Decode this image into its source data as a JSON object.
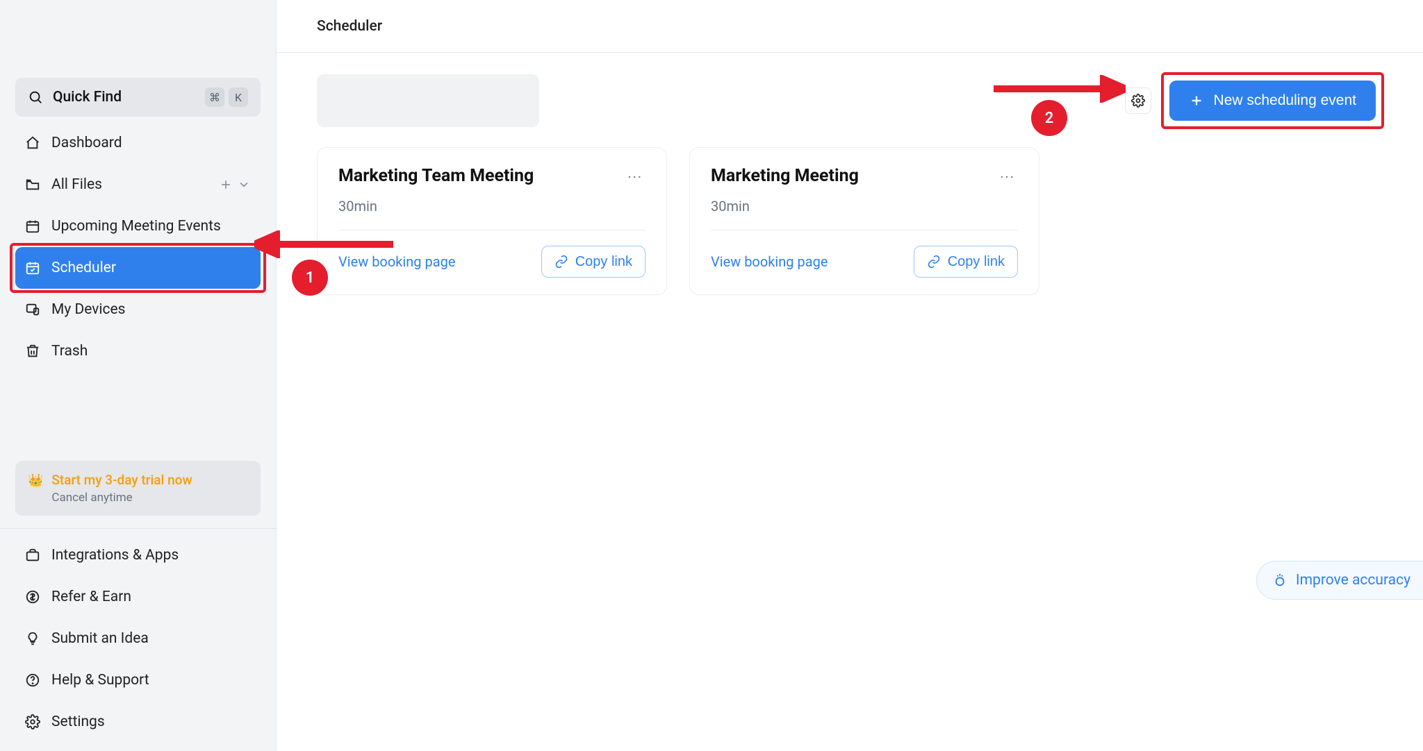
{
  "sidebar": {
    "quick_find": {
      "label": "Quick Find",
      "shortcut_mod": "⌘",
      "shortcut_key": "K"
    },
    "items": [
      {
        "label": "Dashboard"
      },
      {
        "label": "All Files"
      },
      {
        "label": "Upcoming Meeting Events"
      },
      {
        "label": "Scheduler"
      },
      {
        "label": "My Devices"
      },
      {
        "label": "Trash"
      }
    ],
    "trial": {
      "title": "Start my 3-day trial now",
      "subtitle": "Cancel anytime"
    },
    "bottom": [
      {
        "label": "Integrations & Apps"
      },
      {
        "label": "Refer & Earn"
      },
      {
        "label": "Submit an Idea"
      },
      {
        "label": "Help & Support"
      },
      {
        "label": "Settings"
      }
    ]
  },
  "header": {
    "title": "Scheduler"
  },
  "toolbar": {
    "new_event_label": "New scheduling event"
  },
  "cards": [
    {
      "title": "Marketing Team Meeting",
      "duration": "30min",
      "view_label": "View booking page",
      "copy_label": "Copy link"
    },
    {
      "title": "Marketing Meeting",
      "duration": "30min",
      "view_label": "View booking page",
      "copy_label": "Copy link"
    }
  ],
  "improve": {
    "label": "Improve accuracy"
  },
  "annotations": {
    "badge1": "1",
    "badge2": "2"
  }
}
